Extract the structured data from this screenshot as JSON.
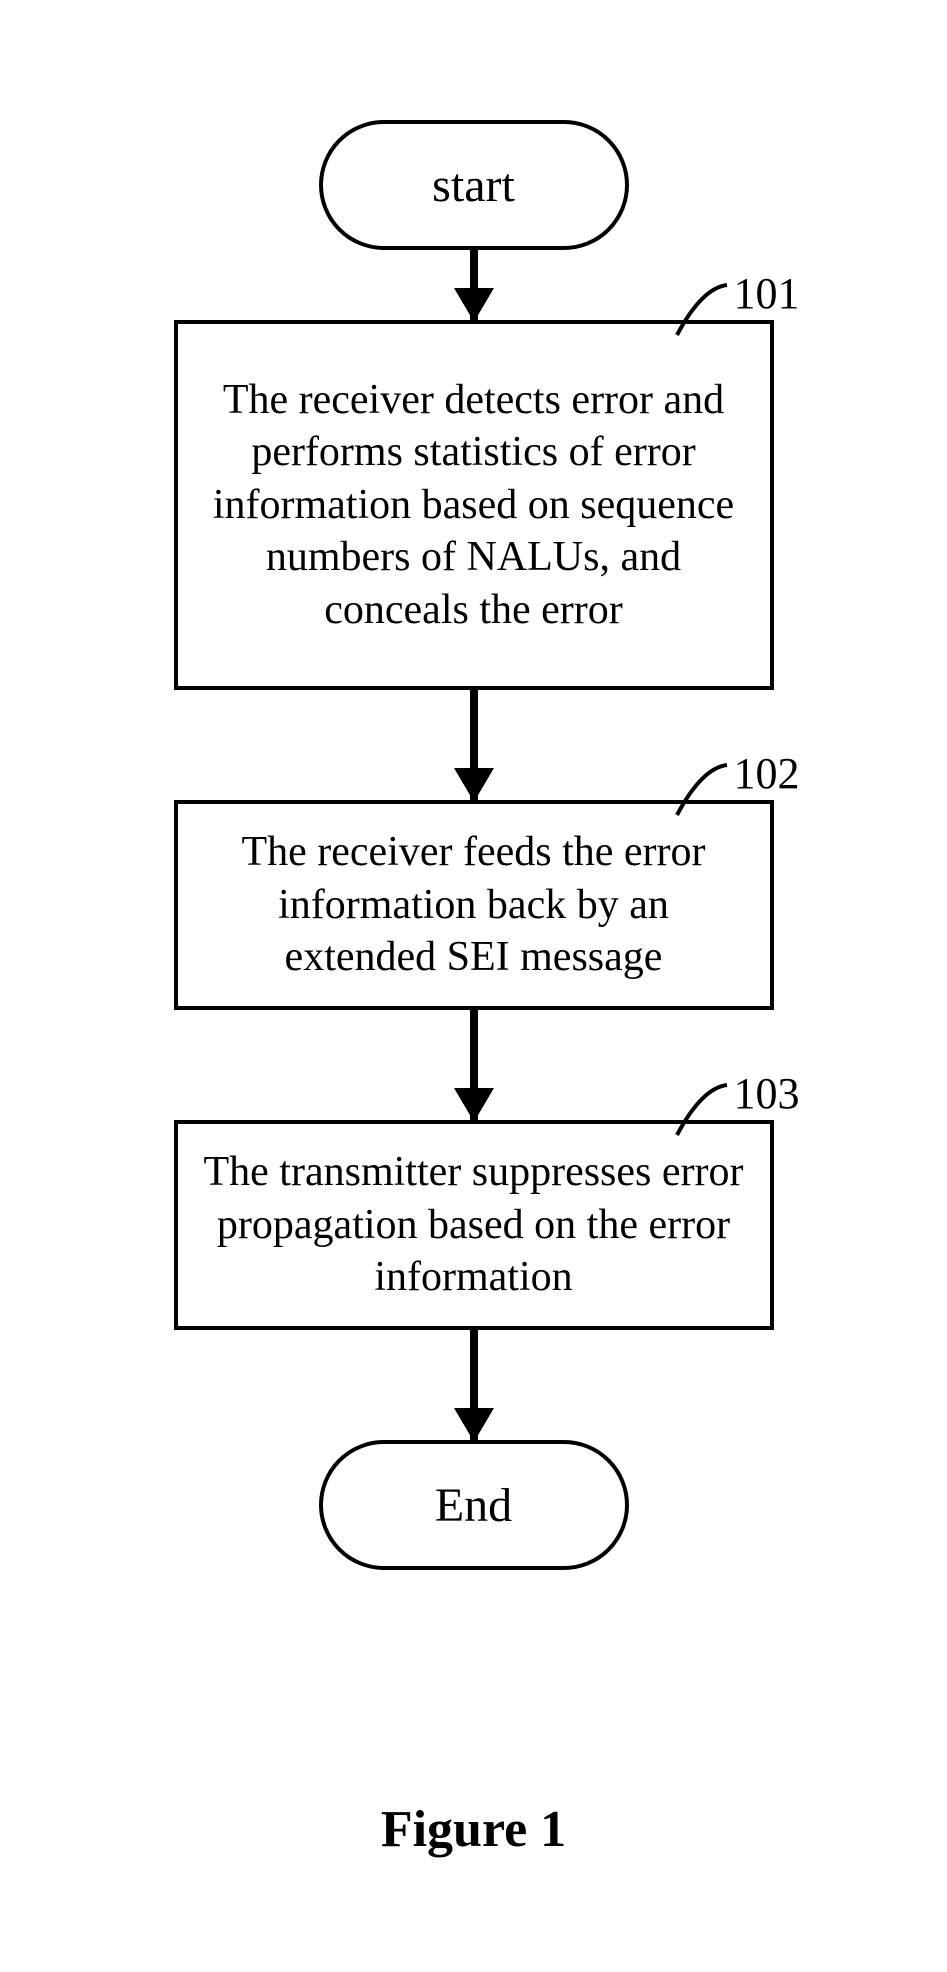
{
  "flow": {
    "start_label": "start",
    "end_label": "End",
    "steps": [
      {
        "ref": "101",
        "text": "The receiver detects error and performs statistics of error information based on sequence numbers of NALUs, and conceals the error"
      },
      {
        "ref": "102",
        "text": "The receiver feeds the error information back by an extended SEI message"
      },
      {
        "ref": "103",
        "text": "The transmitter suppresses error propagation based on the error information"
      }
    ]
  },
  "caption": "Figure 1"
}
